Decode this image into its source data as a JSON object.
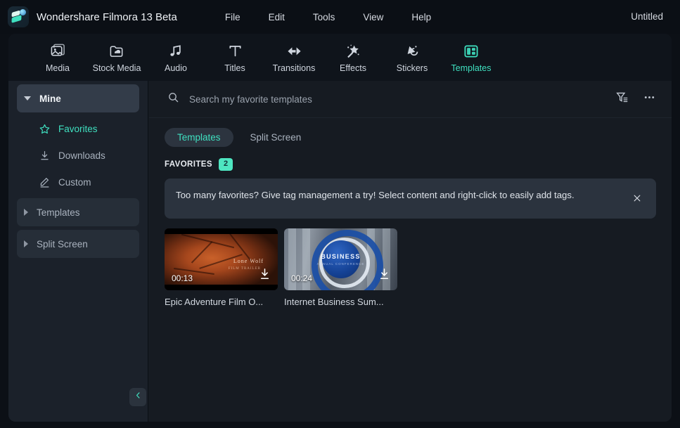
{
  "titlebar": {
    "app_name": "Wondershare Filmora 13 Beta",
    "logo_icon": "filmora-logo-icon",
    "menus": [
      {
        "label": "File"
      },
      {
        "label": "Edit"
      },
      {
        "label": "Tools"
      },
      {
        "label": "View"
      },
      {
        "label": "Help"
      }
    ],
    "project_name": "Untitled"
  },
  "toolbar": {
    "items": [
      {
        "label": "Media",
        "icon": "media-image-icon",
        "active": false
      },
      {
        "label": "Stock Media",
        "icon": "stock-media-cloud-folder-icon",
        "active": false
      },
      {
        "label": "Audio",
        "icon": "audio-note-icon",
        "active": false
      },
      {
        "label": "Titles",
        "icon": "titles-text-icon",
        "active": false
      },
      {
        "label": "Transitions",
        "icon": "transitions-arrow-icon",
        "active": false
      },
      {
        "label": "Effects",
        "icon": "effects-wand-icon",
        "active": false
      },
      {
        "label": "Stickers",
        "icon": "stickers-shapes-icon",
        "active": false
      },
      {
        "label": "Templates",
        "icon": "templates-layout-icon",
        "active": true
      }
    ]
  },
  "sidebar": {
    "items": [
      {
        "label": "Mine",
        "type": "group",
        "expanded": true,
        "icon": "chevron-down-icon"
      },
      {
        "label": "Favorites",
        "type": "child",
        "active": true,
        "icon": "star-icon"
      },
      {
        "label": "Downloads",
        "type": "child",
        "active": false,
        "icon": "download-icon"
      },
      {
        "label": "Custom",
        "type": "child",
        "active": false,
        "icon": "pencil-icon"
      },
      {
        "label": "Templates",
        "type": "group-sub",
        "expanded": false,
        "icon": "chevron-right-icon"
      },
      {
        "label": "Split Screen",
        "type": "group-sub",
        "expanded": false,
        "icon": "chevron-right-icon"
      }
    ],
    "collapse_button": "collapse-sidebar-icon"
  },
  "search": {
    "placeholder": "Search my favorite templates",
    "value": "",
    "icon": "search-icon",
    "filter_icon": "filter-icon",
    "more_icon": "more-options-icon"
  },
  "tabs": [
    {
      "label": "Templates",
      "active": true
    },
    {
      "label": "Split Screen",
      "active": false
    }
  ],
  "section": {
    "title": "FAVORITES",
    "count": "2"
  },
  "banner": {
    "message": "Too many favorites? Give tag management a try! Select content and right-click to easily add tags.",
    "close_icon": "close-icon"
  },
  "cards": [
    {
      "title": "Epic Adventure Film O...",
      "duration": "00:13",
      "download_icon": "download-icon",
      "thumb_title": "Lone Wolf",
      "thumb_subtitle": "FILM TRAILER"
    },
    {
      "title": "Internet Business Sum...",
      "duration": "00:24",
      "download_icon": "download-icon",
      "thumb_title": "BUSINESS",
      "thumb_subtitle": "ANNUAL CONFERENCE"
    }
  ],
  "colors": {
    "accent": "#3fe0c0",
    "badge": "#4ee6c1",
    "panel_bg": "#161b22",
    "sidebar_bg": "#1b212a",
    "titlebar_bg": "#0b0f15",
    "toolbar_bg": "#0f141b",
    "banner_bg": "#2b333e"
  }
}
